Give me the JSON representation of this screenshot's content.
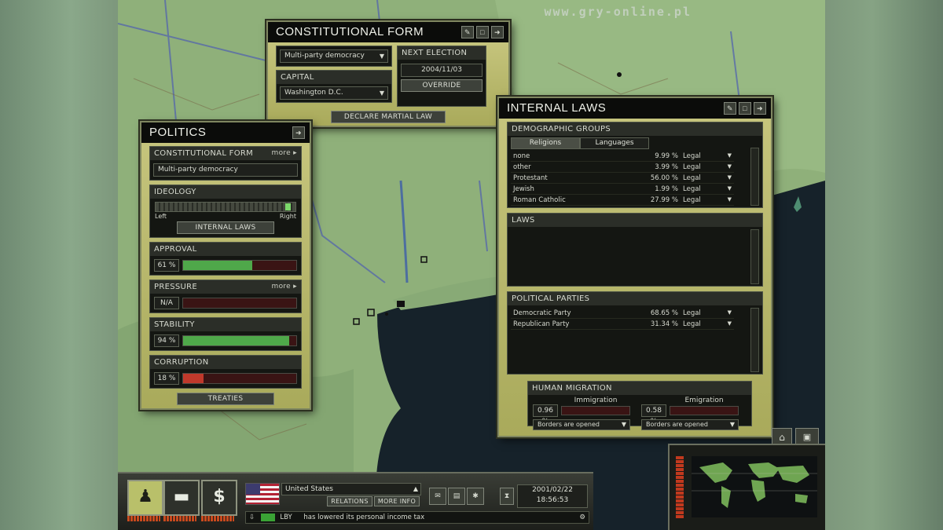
{
  "watermark": "www.gry-online.pl",
  "constitutional": {
    "title": "CONSTITUTIONAL FORM",
    "form_value": "Multi-party democracy",
    "next_election_label": "NEXT ELECTION",
    "next_election_date": "2004/11/03",
    "override_label": "OVERRIDE",
    "capital_label": "CAPITAL",
    "capital_value": "Washington D.C.",
    "martial_law_label": "DECLARE MARTIAL LAW"
  },
  "politics": {
    "title": "POLITICS",
    "constitutional_label": "CONSTITUTIONAL FORM",
    "more_label": "more ▸",
    "constitutional_value": "Multi-party democracy",
    "ideology_label": "IDEOLOGY",
    "ideology_left": "Left",
    "ideology_right": "Right",
    "ideology_level": 0.97,
    "internal_laws_button": "INTERNAL LAWS",
    "approval_label": "APPROVAL",
    "approval_value": "61 %",
    "approval_level": 0.61,
    "pressure_label": "PRESSURE",
    "pressure_value": "N/A",
    "stability_label": "STABILITY",
    "stability_value": "94 %",
    "stability_level": 0.94,
    "corruption_label": "CORRUPTION",
    "corruption_value": "18 %",
    "corruption_level": 0.18,
    "treaties_button": "TREATIES"
  },
  "internal_laws": {
    "title": "INTERNAL LAWS",
    "demographic_label": "DEMOGRAPHIC GROUPS",
    "tabs": [
      "Religions",
      "Languages"
    ],
    "religions": [
      {
        "name": "none",
        "pct": "9.99 %",
        "status": "Legal"
      },
      {
        "name": "other",
        "pct": "3.99 %",
        "status": "Legal"
      },
      {
        "name": "Protestant",
        "pct": "56.00 %",
        "status": "Legal"
      },
      {
        "name": "Jewish",
        "pct": "1.99 %",
        "status": "Legal"
      },
      {
        "name": "Roman Catholic",
        "pct": "27.99 %",
        "status": "Legal"
      }
    ],
    "laws_label": "LAWS",
    "parties_label": "POLITICAL PARTIES",
    "parties": [
      {
        "name": "Democratic Party",
        "pct": "68.65 %",
        "status": "Legal"
      },
      {
        "name": "Republican Party",
        "pct": "31.34 %",
        "status": "Legal"
      }
    ],
    "migration_label": "HUMAN MIGRATION",
    "immigration_label": "Immigration",
    "immigration_value": "0.96 %",
    "immigration_policy": "Borders are opened",
    "emigration_label": "Emigration",
    "emigration_value": "0.58 %",
    "emigration_policy": "Borders are opened"
  },
  "hud": {
    "country": "United States",
    "relations_label": "RELATIONS",
    "more_info_label": "MORE INFO",
    "date": "2001/02/22",
    "time": "18:56:53",
    "news_code": "LBY",
    "news_text": "has lowered its personal income tax",
    "dollar_symbol": "$"
  },
  "colors": {
    "bar_green": "#4fa84a",
    "bar_red": "#c0392b",
    "panel_olive": "#b7b86a",
    "water": "#16222a"
  }
}
